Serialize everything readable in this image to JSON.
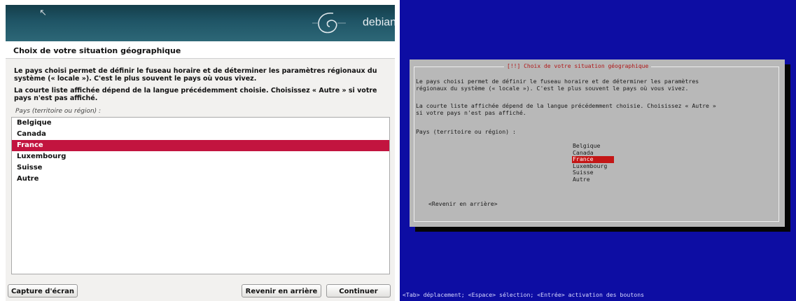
{
  "gui": {
    "brand": "debian",
    "brand_mark": "®",
    "title": "Choix de votre situation géographique",
    "paragraph1": "Le pays choisi permet de définir le fuseau horaire et de déterminer les paramètres régionaux du système (« locale »). C'est le plus souvent le pays où vous vivez.",
    "paragraph2": "La courte liste affichée dépend de la langue précédemment choisie. Choisissez « Autre » si votre pays n'est pas affiché.",
    "prompt": "Pays (territoire ou région) :",
    "countries": [
      "Belgique",
      "Canada",
      "France",
      "Luxembourg",
      "Suisse",
      "Autre"
    ],
    "selected": "France",
    "buttons": {
      "screenshot": "Capture d'écran",
      "back": "Revenir en arrière",
      "continue": "Continuer"
    },
    "colors": {
      "banner": "#1f5566",
      "selection": "#c2143f"
    }
  },
  "tui": {
    "title": "[!!] Choix de votre situation géographique",
    "paragraph1": "Le pays choisi permet de définir le fuseau horaire et de déterminer les paramètres\nrégionaux du système (« locale »). C'est le plus souvent le pays où vous vivez.",
    "paragraph2": "La courte liste affichée dépend de la langue précédemment choisie. Choisissez « Autre »\nsi votre pays n'est pas affiché.",
    "prompt": "Pays (territoire ou région) :",
    "countries": [
      "Belgique",
      "Canada",
      "France",
      "Luxembourg",
      "Suisse",
      "Autre"
    ],
    "selected": "France",
    "back_button": "<Revenir en arrière>",
    "status_bar": "<Tab> déplacement; <Espace> sélection; <Entrée> activation des boutons",
    "colors": {
      "background": "#0d0da3",
      "dialog": "#b8b8b8",
      "selection": "#c41616"
    }
  }
}
